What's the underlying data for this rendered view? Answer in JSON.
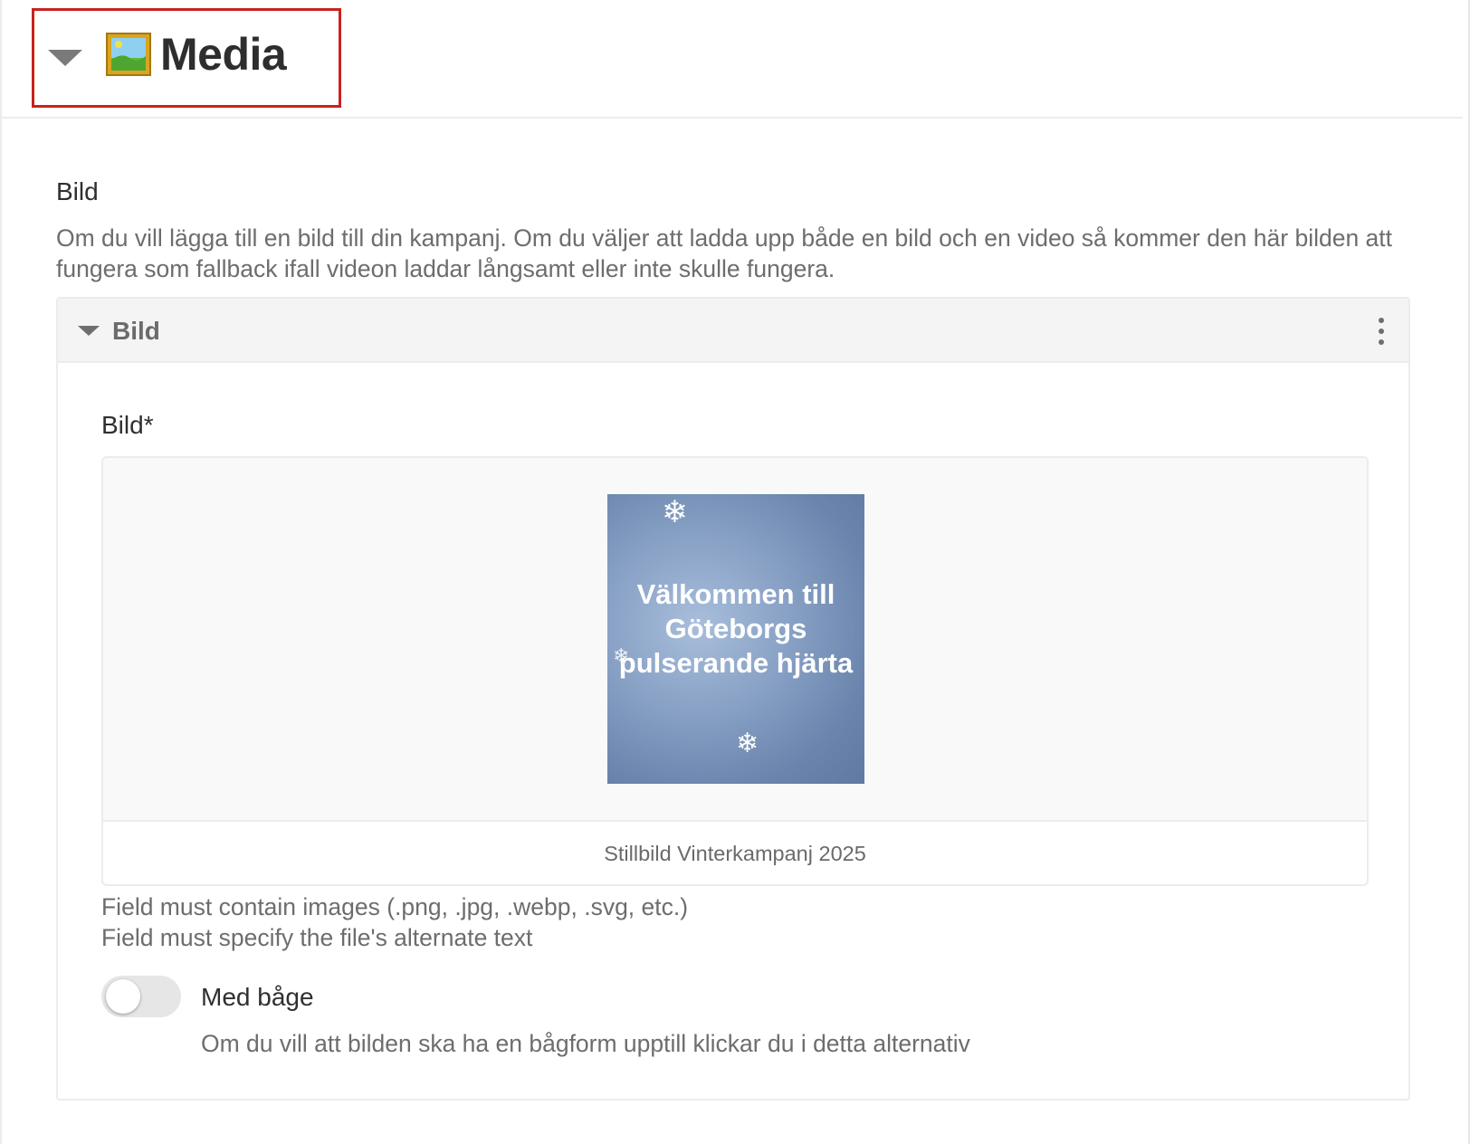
{
  "section": {
    "title": "Media",
    "emoji_icon": "framed-picture-icon"
  },
  "field": {
    "label": "Bild",
    "description": "Om du vill lägga till en bild till din kampanj. Om du väljer att ladda upp både en bild och en video så kommer den här bilden att fungera som fallback ifall videon laddar långsamt eller inte skulle fungera."
  },
  "panel": {
    "title": "Bild",
    "menu_icon": "kebab-menu-icon",
    "image_field": {
      "label": "Bild*",
      "thumbnail_text": "Välkommen till Göteborgs pulserande hjärta",
      "caption": "Stillbild Vinterkampanj 2025"
    },
    "help": [
      "Field must contain images (.png, .jpg, .webp, .svg, etc.)",
      "Field must specify the file's alternate text"
    ],
    "toggle": {
      "label": "Med båge",
      "checked": false,
      "description": "Om du vill att bilden ska ha en bågform upptill klickar du i detta alternativ"
    }
  },
  "colors": {
    "highlight_border": "#c9221f",
    "panel_header_bg": "#f4f4f4",
    "thumbnail_blue": "#7f98bf"
  }
}
